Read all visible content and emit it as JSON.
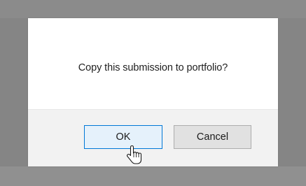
{
  "dialog": {
    "message": "Copy this submission to portfolio?",
    "buttons": {
      "ok_label": "OK",
      "cancel_label": "Cancel"
    }
  },
  "colors": {
    "backdrop": "#858585",
    "dialog_bg": "#ffffff",
    "footer_bg": "#f2f2f2",
    "ok_bg": "#e5f1fb",
    "ok_border": "#0078d7",
    "cancel_bg": "#e1e1e1",
    "cancel_border": "#adadad"
  },
  "cursor": {
    "icon": "hand-pointer-icon"
  }
}
